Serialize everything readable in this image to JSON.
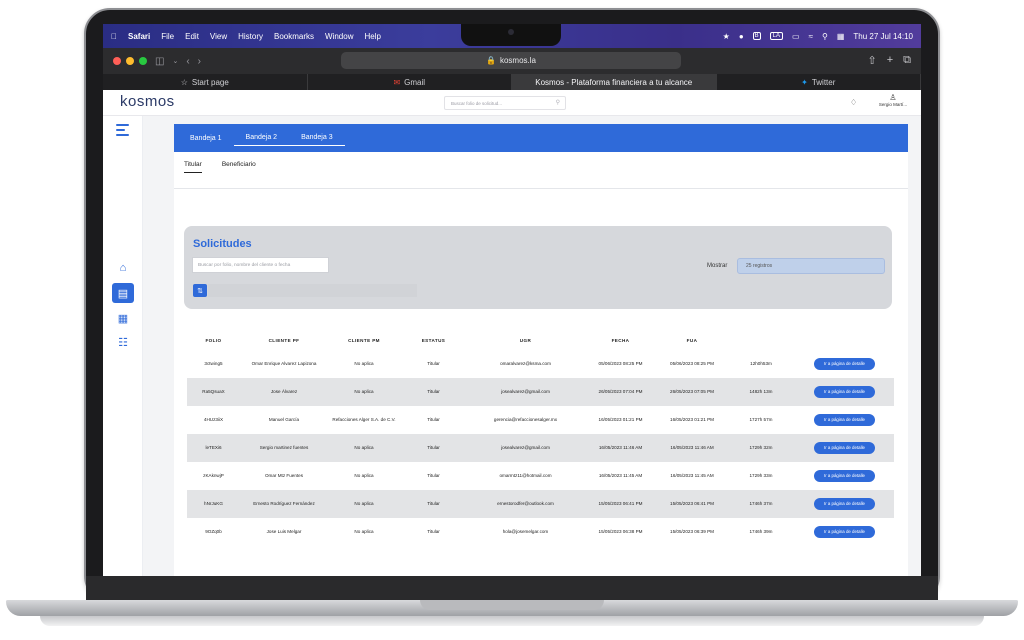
{
  "menubar": {
    "apple_icon": "apple-icon",
    "app_name": "Safari",
    "menus": [
      "File",
      "Edit",
      "View",
      "History",
      "Bookmarks",
      "Window",
      "Help"
    ],
    "clock": "Thu 27 Jul  14:10",
    "layout_badge": "LA"
  },
  "browser": {
    "url": "kosmos.la",
    "tabs": [
      {
        "label": "Start page",
        "icon": "star-icon"
      },
      {
        "label": "Gmail",
        "icon": "gmail-icon"
      },
      {
        "label": "Kosmos - Plataforma financiera a tu alcance",
        "icon": ""
      },
      {
        "label": "Twitter",
        "icon": "twitter-icon"
      }
    ]
  },
  "header": {
    "logo": "kosmos",
    "search_placeholder": "Buscar folio de solicitud...",
    "user_name": "Sergio Martí..."
  },
  "bandejas": {
    "items": [
      "Bandeja 1",
      "Bandeja 2",
      "Bandeja 3"
    ]
  },
  "subtabs": {
    "items": [
      "Titular",
      "Beneficiario"
    ]
  },
  "solicitudes": {
    "title": "Solicitudes",
    "search_placeholder": "Buscar por folio, nombre del cliente o fecha",
    "mostrar_label": "Mostrar",
    "registros": "25 registros"
  },
  "table": {
    "headers": [
      "FOLIO",
      "CLIENTE PF",
      "CLIENTE PM",
      "ESTATUS",
      "UGR",
      "FECHA",
      "FUA",
      "",
      ""
    ],
    "button_label": "Ir a página de detalle",
    "rows": [
      {
        "folio": "3ctwing5",
        "pf": "Omar Enrique Alvarez Lapizona",
        "pm": "No aplica",
        "estatus": "Titular",
        "ugr": "omaralvarez@ksma.com",
        "fecha": "05/06/2023 08:25 PM",
        "fua": "05/06/2023 08:25 PM",
        "t": "12h0h53m"
      },
      {
        "folio": "Ra5QsuaX",
        "pf": "Jose Álvarez",
        "pm": "No aplica",
        "estatus": "Titular",
        "ugr": "josealvarez@gmail.com",
        "fecha": "26/05/2023 07:04 PM",
        "fua": "26/05/2023 07:05 PM",
        "t": "1482h 13m"
      },
      {
        "folio": "4HUz3iiX",
        "pf": "Manuel García",
        "pm": "Refacciones Alger S.A. de C.V.",
        "estatus": "Titular",
        "ugr": "gerencia@refaccionesalger.mx",
        "fecha": "16/05/2023 01:21 PM",
        "fua": "16/05/2023 01:21 PM",
        "t": "1727h 57m"
      },
      {
        "folio": "leTEXi6",
        "pf": "Sergio martinez fuentes",
        "pm": "No aplica",
        "estatus": "Titular",
        "ugr": "josealvarez@gmail.com",
        "fecha": "16/05/2023 11:46 AM",
        "fua": "16/05/2023 11:46 AM",
        "t": "1729h 32m"
      },
      {
        "folio": "zKAknwjP",
        "pf": "Omar Mtz Fuentes",
        "pm": "No aplica",
        "estatus": "Titular",
        "ugr": "omarmtz11@hotmail.com",
        "fecha": "16/05/2023 11:45 AM",
        "fua": "16/05/2023 11:45 AM",
        "t": "1729h 33m"
      },
      {
        "folio": "hNrJuKG",
        "pf": "Ernesto Rodríguez Fernández",
        "pm": "No aplica",
        "estatus": "Titular",
        "ugr": "ernestorodfer@outlook.com",
        "fecha": "15/05/2023 06:41 PM",
        "fua": "15/05/2023 06:41 PM",
        "t": "1746h 37m"
      },
      {
        "folio": "9OZq0b",
        "pf": "Jose Luis Melgar",
        "pm": "No aplica",
        "estatus": "Titular",
        "ugr": "hola@josemelgar.com",
        "fecha": "15/05/2023 06:38 PM",
        "fua": "15/05/2023 06:39 PM",
        "t": "1746h 39m"
      }
    ]
  },
  "colors": {
    "primary": "#2f6ad9",
    "menubar": "#2a2d84",
    "panel_gray": "#d6d8dc"
  }
}
